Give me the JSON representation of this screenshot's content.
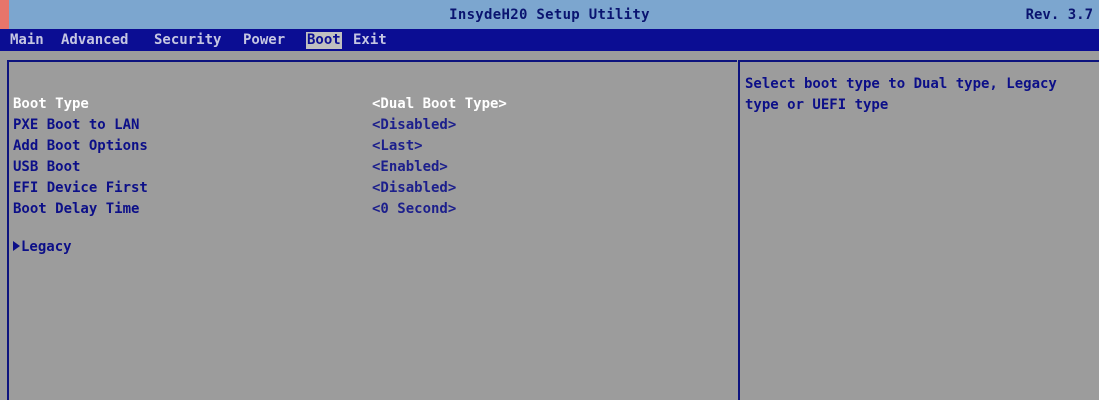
{
  "window": {
    "title": "InsydeH20 Setup Utility",
    "revision": "Rev. 3.7"
  },
  "colors": {
    "title_bg": "#7ca6cf",
    "menu_bg": "#0b0d93",
    "panel_bg": "#9c9c9c",
    "text": "#0c0f88",
    "selected_text": "#ffffff",
    "accent": "#e8756a"
  },
  "menu": {
    "items": [
      {
        "label": "Main"
      },
      {
        "label": "Advanced"
      },
      {
        "label": "Security"
      },
      {
        "label": "Power"
      },
      {
        "label": "Boot",
        "active": true
      },
      {
        "label": "Exit"
      }
    ]
  },
  "settings": [
    {
      "label": "Boot Type",
      "value": "<Dual Boot Type>",
      "selected": true
    },
    {
      "label": "PXE Boot to LAN",
      "value": "<Disabled>"
    },
    {
      "label": "Add Boot Options",
      "value": "<Last>"
    },
    {
      "label": "USB Boot",
      "value": "<Enabled>"
    },
    {
      "label": "EFI Device First",
      "value": "<Disabled>"
    },
    {
      "label": "Boot Delay Time",
      "value": "<0 Second>"
    }
  ],
  "submenu": {
    "label": "Legacy",
    "icon": "submenu-arrow-icon"
  },
  "help": {
    "text": "Select boot type to Dual type, Legacy\ntype or UEFI type"
  }
}
